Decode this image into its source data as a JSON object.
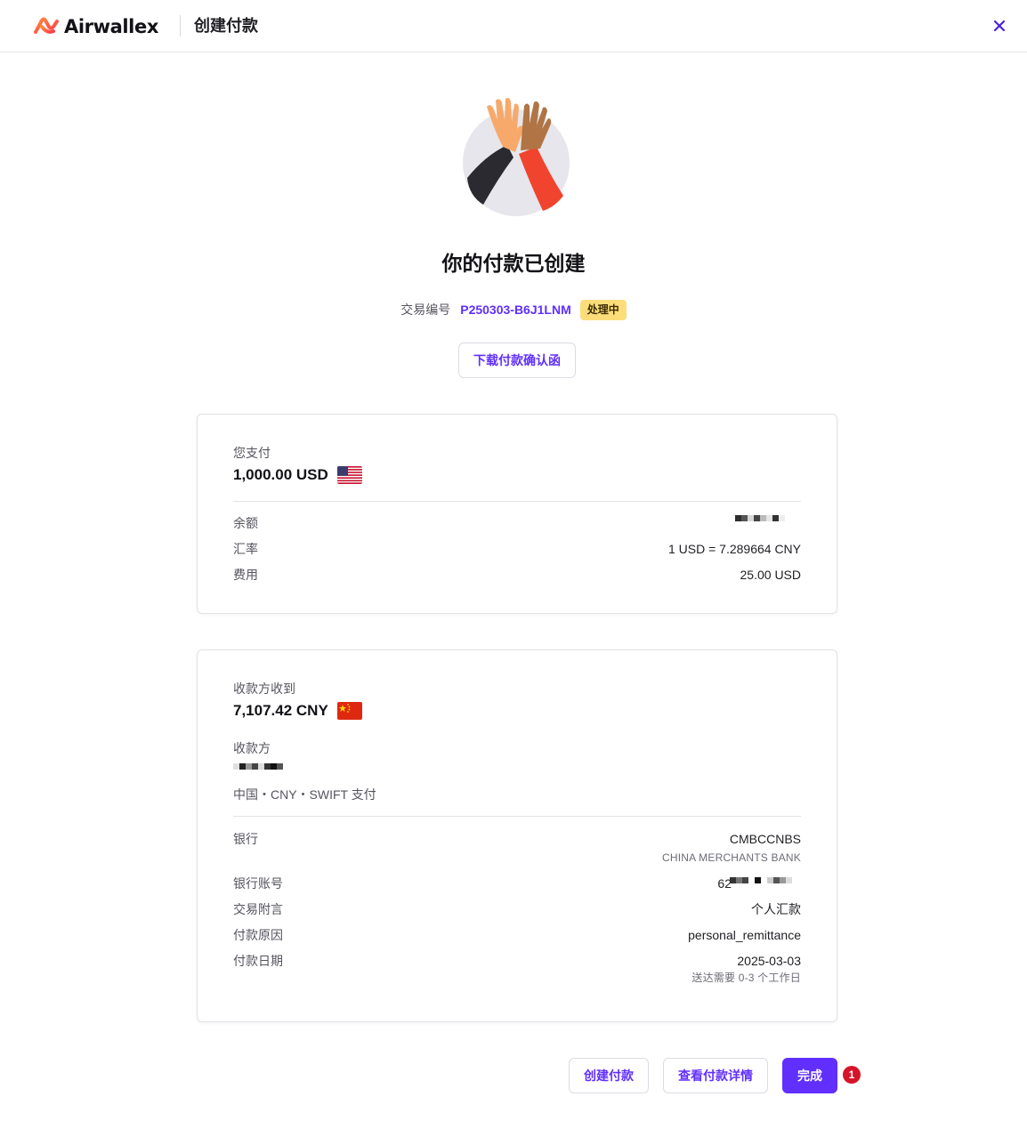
{
  "header": {
    "brand": "Airwallex",
    "title": "创建付款",
    "close_icon": "close-icon"
  },
  "illustration": "high-five-icon",
  "main": {
    "title": "你的付款已创建",
    "txn_label": "交易编号",
    "txn_id": "P250303-B6J1LNM",
    "status": "处理中",
    "download_label": "下载付款确认函"
  },
  "pay_card": {
    "you_pay_label": "您支付",
    "amount": "1,000.00 USD",
    "flag": "us-flag-icon",
    "balance_label": "余额",
    "rate_label": "汇率",
    "rate_value": "1 USD = 7.289664 CNY",
    "fee_label": "费用",
    "fee_value": "25.00 USD"
  },
  "recv_card": {
    "receive_label": "收款方收到",
    "amount": "7,107.42 CNY",
    "flag": "cn-flag-icon",
    "payee_label": "收款方",
    "payee_method": "中国・CNY・SWIFT 支付",
    "bank_label": "银行",
    "bank_code": "CMBCCNBS",
    "bank_name": "CHINA MERCHANTS BANK",
    "account_label": "银行账号",
    "account_prefix": "62",
    "memo_label": "交易附言",
    "memo_value": "个人汇款",
    "reason_label": "付款原因",
    "reason_value": "personal_remittance",
    "date_label": "付款日期",
    "date_value": "2025-03-03",
    "delivery_note": "送达需要 0-3 个工作日"
  },
  "footer": {
    "create_label": "创建付款",
    "view_label": "查看付款详情",
    "done_label": "完成",
    "badge_count": "1"
  },
  "colors": {
    "accent": "#612fff",
    "status_bg": "#fbdd7a",
    "notif": "#d6152a",
    "brand_orange": "#ff4f42"
  }
}
